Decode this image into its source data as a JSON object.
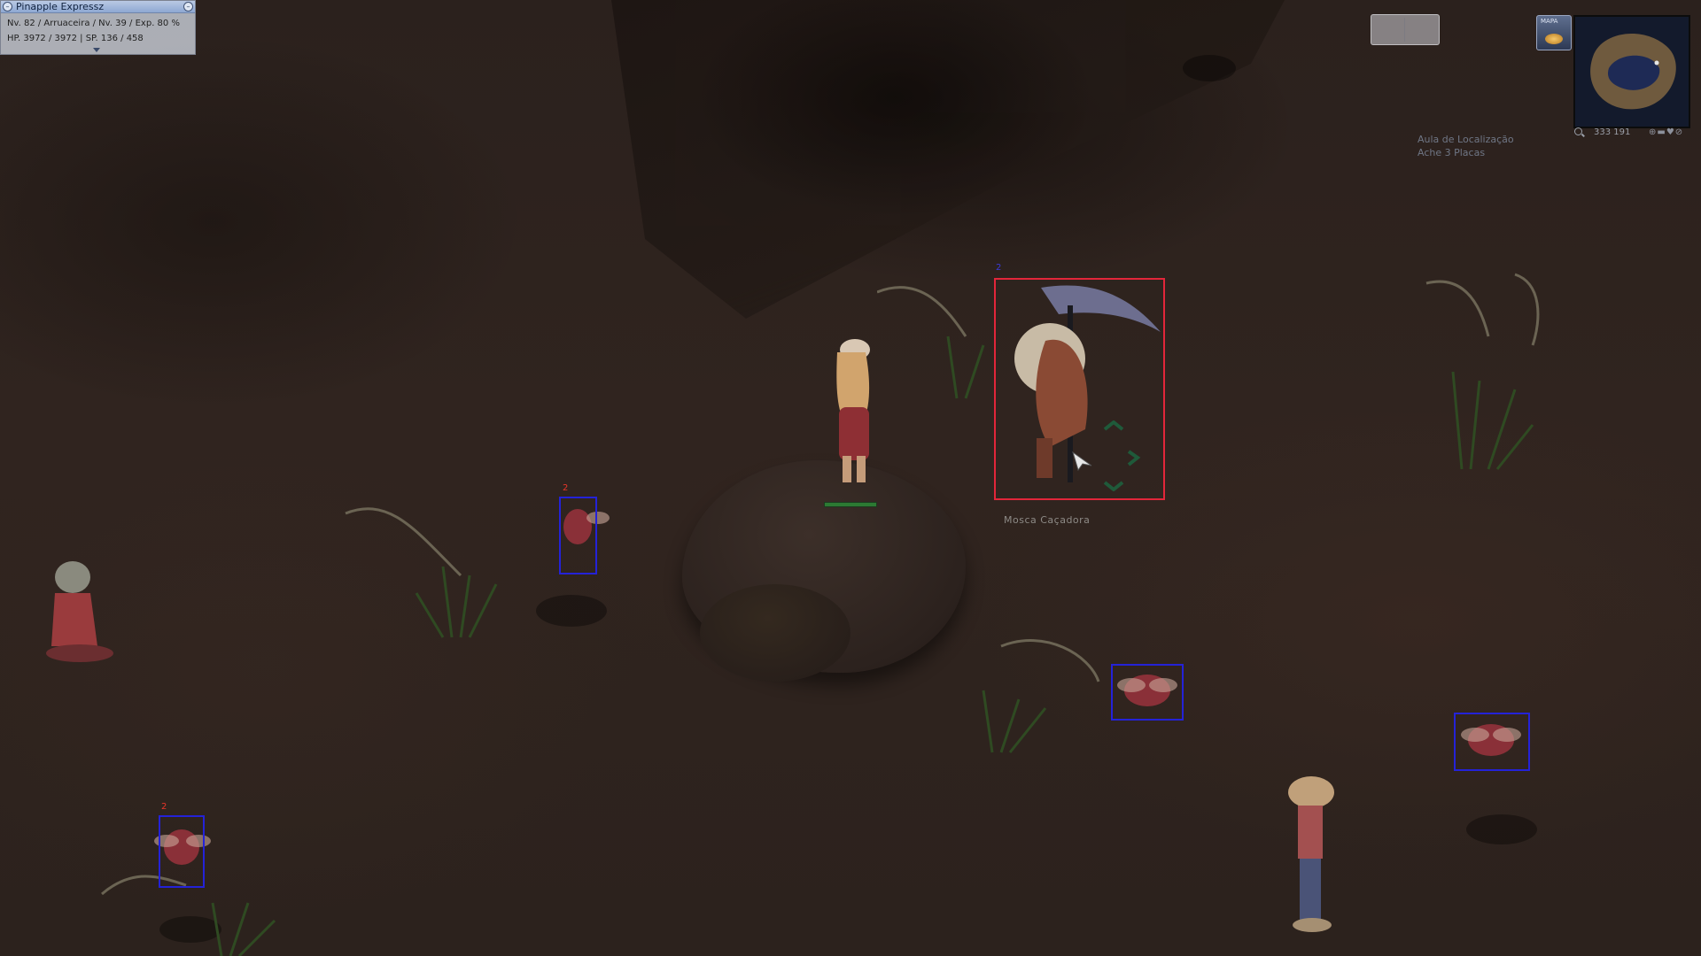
{
  "status_window": {
    "title": "Pinapple Expressz",
    "line1": "Nv. 82 / Arruaceira / Nv. 39 / Exp. 80 %",
    "line2": "HP. 3972 / 3972 | SP. 136 / 458",
    "minimize_glyph": "–",
    "close_glyph": "–"
  },
  "minimap": {
    "coordinates": "333  191",
    "button_label": "MAPA"
  },
  "quest": {
    "title": "Aula de Localização",
    "task": "Ache 3 Placas"
  },
  "target": {
    "name": "Mosca Caçadora",
    "level_marker": "2"
  },
  "markers": {
    "small_target_1": "2",
    "small_target_2": "2"
  },
  "colors": {
    "target_box_blue": "#2422d8",
    "target_box_red": "#e2263a",
    "status_title_bar": "#8ea8d2"
  }
}
